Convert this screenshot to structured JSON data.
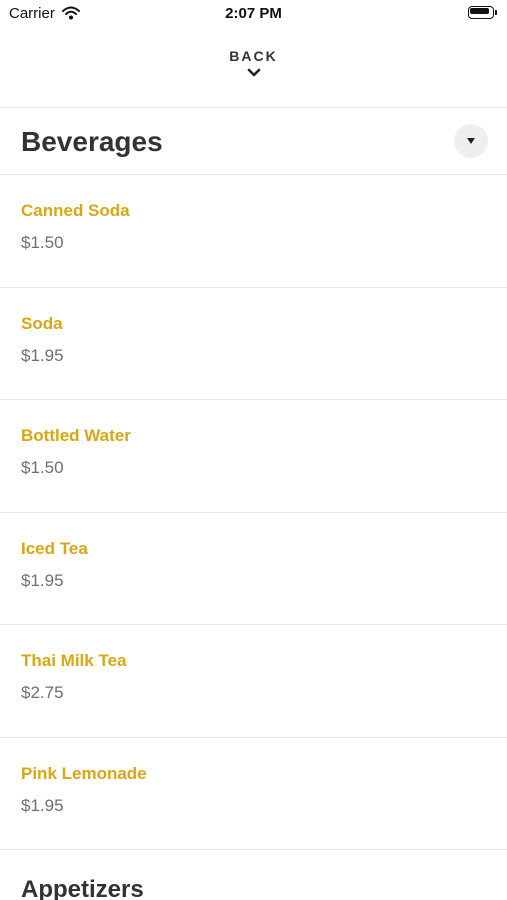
{
  "status_bar": {
    "carrier": "Carrier",
    "time": "2:07 PM"
  },
  "nav": {
    "back_label": "BACK"
  },
  "category": {
    "title": "Beverages"
  },
  "items": [
    {
      "name": "Canned Soda",
      "price": "$1.50"
    },
    {
      "name": "Soda",
      "price": "$1.95"
    },
    {
      "name": "Bottled Water",
      "price": "$1.50"
    },
    {
      "name": "Iced Tea",
      "price": "$1.95"
    },
    {
      "name": "Thai Milk Tea",
      "price": "$2.75"
    },
    {
      "name": "Pink Lemonade",
      "price": "$1.95"
    }
  ],
  "next_category": {
    "title": "Appetizers"
  },
  "colors": {
    "accent": "#d7a714",
    "price": "#6f6f6f",
    "heading": "#333333",
    "divider": "#ececec"
  },
  "icons": {
    "wifi": "wifi-icon",
    "battery": "battery-icon",
    "back": "chevron-down-icon",
    "toggle": "caret-down-icon"
  }
}
